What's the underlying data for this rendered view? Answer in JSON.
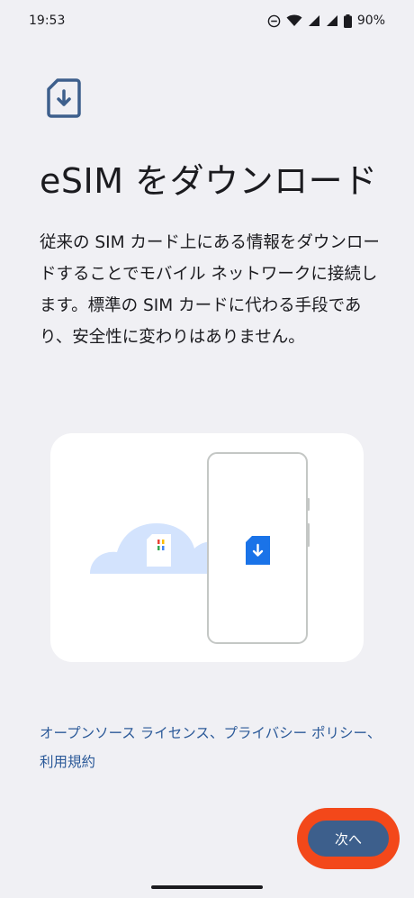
{
  "status_bar": {
    "time": "19:53",
    "battery": "90%",
    "icons": [
      "do-not-disturb-icon",
      "wifi-icon",
      "signal-icon",
      "signal-icon",
      "battery-icon"
    ]
  },
  "header": {
    "icon": "esim-download-icon",
    "title": "eSIM をダウンロード"
  },
  "description": "従来の SIM カード上にある情報をダウンロードすることでモバイル ネットワークに接続します。標準の SIM カードに代わる手段であり、安全性に変わりはありません。",
  "illustration": {
    "icons": [
      "cloud-icon",
      "sim-card-icon",
      "phone-icon",
      "esim-download-icon"
    ],
    "colors": {
      "cloud": "#d3e3fd",
      "phone_outline": "#c4c7c5",
      "esim_blue": "#1a73e8"
    }
  },
  "links": {
    "open_source": "オープンソース ライセンス",
    "sep1": "、",
    "privacy": "プライバシー ポリシー",
    "sep2": "、",
    "terms": "利用規約"
  },
  "footer": {
    "next_label": "次へ"
  },
  "colors": {
    "background": "#f0f0f4",
    "accent": "#3d5f8c",
    "link": "#2c5a99",
    "highlight": "#f3481a"
  }
}
